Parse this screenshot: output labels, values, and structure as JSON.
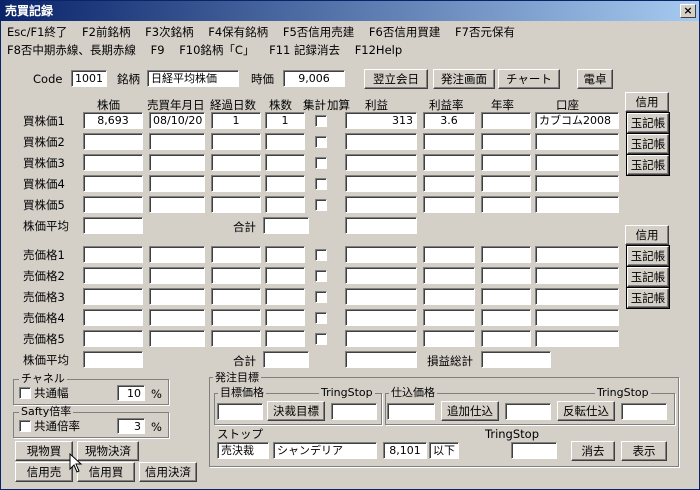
{
  "window": {
    "title": "売買記録",
    "close_glyph": "×"
  },
  "menu": {
    "row1": [
      "Esc/F1終了",
      "F2前銘柄",
      "F3次銘柄",
      "F4保有銘柄",
      "F5否信用売建",
      "F6否信用買建",
      "F7否元保有"
    ],
    "row2": [
      "F8否中期赤線、長期赤線",
      "F9",
      "F10銘柄「C」",
      "F11 記録消去",
      "F12Help"
    ]
  },
  "header": {
    "code_label": "Code",
    "code_value": "1001",
    "name_label": "銘柄",
    "name_value": "日経平均株価",
    "price_label": "時価",
    "price_value": "9,006",
    "buttons": [
      "翌立会日",
      "発注画面",
      "チャート",
      "電卓"
    ]
  },
  "columns": [
    "株価",
    "売買年月日",
    "経過日数",
    "株数",
    "集計",
    "加算",
    "利益",
    "利益率",
    "年率",
    "口座"
  ],
  "buy": {
    "labels": [
      "買株価1",
      "買株価2",
      "買株価3",
      "買株価4",
      "買株価5"
    ],
    "row1": {
      "price": "8,693",
      "date": "08/10/20",
      "days": "1",
      "shares": "1",
      "profit": "313",
      "rate": "3.6",
      "annual": "",
      "account": "カブコム2008"
    },
    "avg_label": "株価平均",
    "total_label": "合計",
    "credit_button": "信用",
    "ledger_button": "玉記帳"
  },
  "sell": {
    "labels": [
      "売価格1",
      "売価格2",
      "売価格3",
      "売価格4",
      "売価格5"
    ],
    "avg_label": "株価平均",
    "total_label": "合計",
    "pl_total_label": "損益総計",
    "credit_button": "信用",
    "ledger_button": "玉記帳"
  },
  "channel": {
    "title": "チャネル",
    "common_label": "共通幅",
    "value": "10",
    "unit": "%"
  },
  "safety": {
    "title": "Safty倍率",
    "common_label": "共通倍率",
    "value": "3",
    "unit": "%"
  },
  "order": {
    "title": "発注目標",
    "target_label": "目標価格",
    "tring_stop": "TringStop",
    "settle_button": "決裁目標",
    "cost_label": "仕込価格",
    "add_button": "追加仕込",
    "reverse_button": "反転仕込",
    "stop_label": "ストップ",
    "stop_type": "売決裁",
    "stop_name": "シャンデリア",
    "stop_value": "8,101",
    "stop_cond": "以下",
    "clear_button": "消去",
    "show_button": "表示"
  },
  "trade_buttons": [
    "現物買",
    "現物決済",
    "信用売",
    "信用買",
    "信用決済"
  ]
}
